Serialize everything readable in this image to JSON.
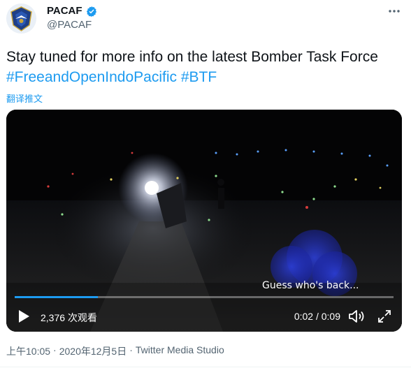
{
  "author": {
    "display_name": "PACAF",
    "handle": "@PACAF",
    "avatar_icon": "pacaf-emblem-icon",
    "verified_icon": "verified-badge-icon"
  },
  "tweet": {
    "text_plain": "Stay tuned for more info on the latest Bomber Task Force ",
    "hashtag_1": "#FreeandOpenIndoPacific",
    "space": " ",
    "hashtag_2": "#BTF",
    "translate_label": "翻译推文"
  },
  "video": {
    "caption": "Guess who's back...",
    "views": "2,376 次观看",
    "time": "0:02 / 0:09",
    "progress": 0.22,
    "progress_color": "#1d9bf0"
  },
  "meta": {
    "time": "上午10:05",
    "separator_1": "·",
    "date": "2020年12月5日",
    "separator_2": "·",
    "source": "Twitter Media Studio"
  },
  "colors": {
    "link": "#1d9bf0",
    "secondary": "#536471",
    "text": "#0f1419"
  }
}
